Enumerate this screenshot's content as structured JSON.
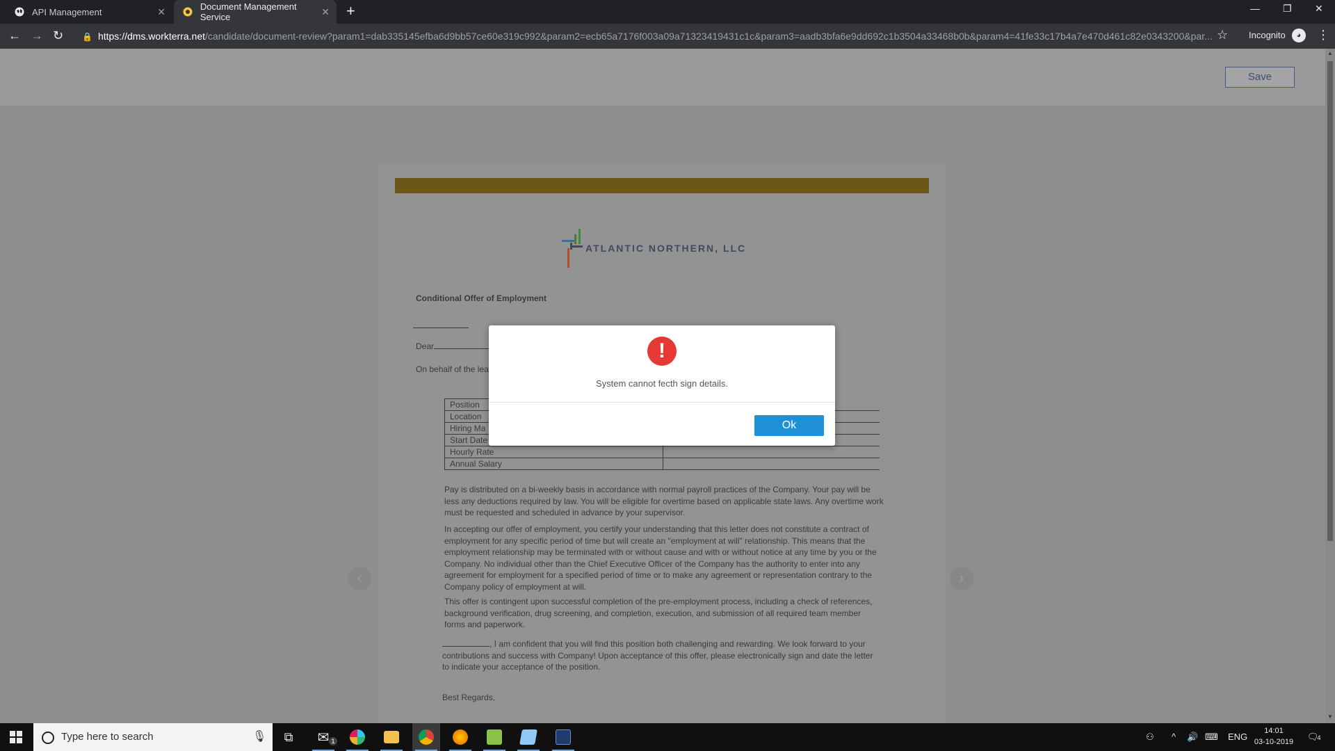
{
  "browser": {
    "tabs": [
      {
        "title": "API Management",
        "active": false
      },
      {
        "title": "Document Management Service",
        "active": true
      }
    ],
    "url_host": "https://dms.workterra.net",
    "url_path": "/candidate/document-review?param1=dab335145efba6d9bb57ce60e319c992&param2=ecb65a7176f003a09a71323419431c1c&param3=aadb3bfa6e9dd692c1b3504a33468b0b&param4=41fe33c17b4a7e470d461c82e0343200&par...",
    "incognito_label": "Incognito"
  },
  "page": {
    "save_label": "Save"
  },
  "document": {
    "logo_text": "ATLANTIC NORTHERN, LLC",
    "title": "Conditional Offer of Employment",
    "dear": "Dear",
    "behalf": "On behalf of the lea",
    "table": [
      "Position",
      "Location",
      "Hiring Ma",
      "Start Date",
      "Hourly Rate",
      "Annual Salary"
    ],
    "p1": "Pay is distributed on a bi-weekly basis in accordance with normal payroll practices of the Company. Your pay will be less any deductions required by law. You will be eligible for overtime based on applicable state laws. Any overtime work must be requested and scheduled in advance by your supervisor.",
    "p2": "In accepting our offer of employment, you certify your understanding that this letter does not constitute a contract of employment for any specific period of time but will create an \"employment at will\" relationship. This means that the employment relationship may be terminated with or without cause and with or without notice at any time by you or the Company. No individual other than the Chief Executive Officer of the Company has the authority to enter into any agreement for employment for a specified period of time or to make any agreement or representation contrary to the Company policy of employment at will.",
    "p3": "This offer is contingent upon successful completion of the pre-employment process, including a check of references, background verification, drug screening, and completion, execution, and submission of all required team member forms and paperwork.",
    "p4": ", I am confident that you will find this position both challenging and rewarding. We look forward to your contributions and success with Company! Upon acceptance of this offer, please electronically sign and date the letter to indicate your acceptance of the position.",
    "regards": "Best Regards,"
  },
  "modal": {
    "icon": "exclamation-icon",
    "message": "System cannot fecth sign details.",
    "ok_label": "Ok"
  },
  "taskbar": {
    "search_placeholder": "Type here to search",
    "language": "ENG",
    "time": "14:01",
    "date": "03-10-2019",
    "notification_count": "4",
    "mail_badge": "1"
  },
  "colors": {
    "ok_button": "#1e90d6",
    "alert_icon": "#e53935",
    "gold_bar": "#6b5518"
  }
}
